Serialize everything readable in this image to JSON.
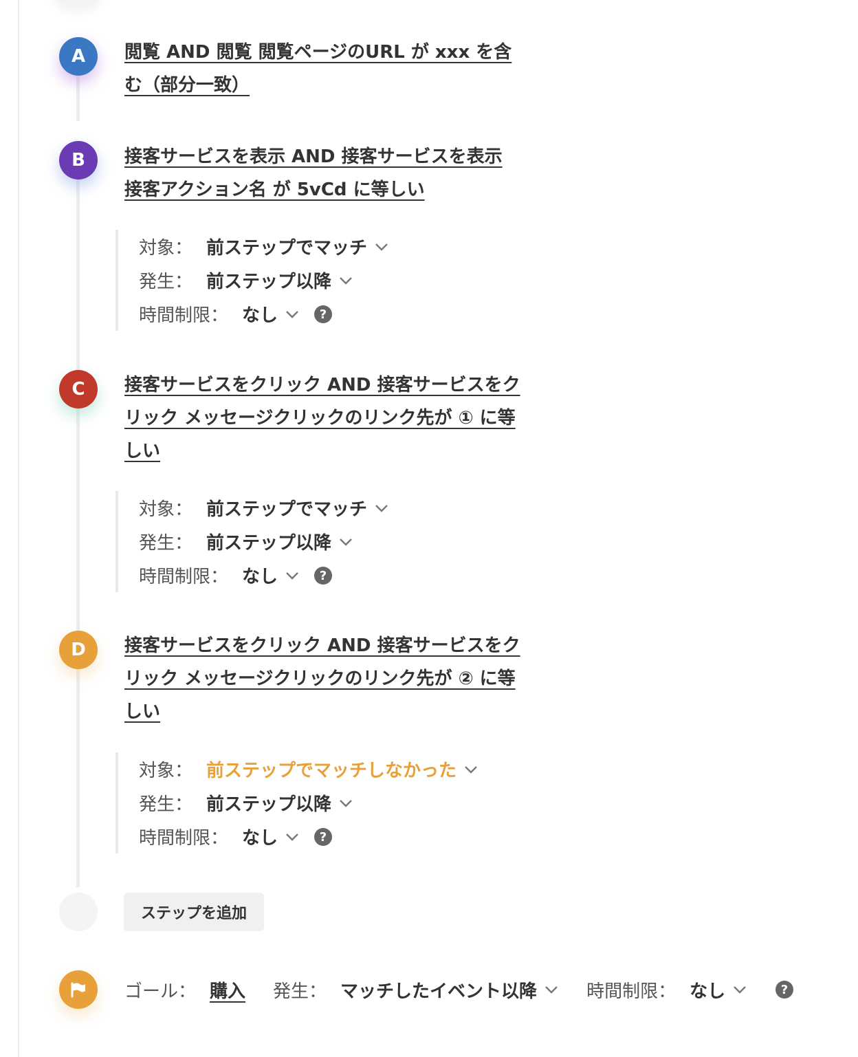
{
  "steps": [
    {
      "letter": "A",
      "title": "閲覧 AND 閲覧 閲覧ページのURL が xxx を含む（部分一致）"
    },
    {
      "letter": "B",
      "title": "接客サービスを表示 AND 接客サービスを表示 接客アクション名 が 5vCd に等しい",
      "target_label": "対象：",
      "target_value": "前ステップでマッチ",
      "occur_label": "発生：",
      "occur_value": "前ステップ以降",
      "time_label": "時間制限：",
      "time_value": "なし"
    },
    {
      "letter": "C",
      "title": "接客サービスをクリック AND 接客サービスをクリック メッセージクリックのリンク先が ① に等しい",
      "target_label": "対象：",
      "target_value": "前ステップでマッチ",
      "occur_label": "発生：",
      "occur_value": "前ステップ以降",
      "time_label": "時間制限：",
      "time_value": "なし"
    },
    {
      "letter": "D",
      "title": "接客サービスをクリック AND 接客サービスをクリック メッセージクリックのリンク先が ② に等しい",
      "target_label": "対象：",
      "target_value": "前ステップでマッチしなかった",
      "occur_label": "発生：",
      "occur_value": "前ステップ以降",
      "time_label": "時間制限：",
      "time_value": "なし"
    }
  ],
  "add_step_label": "ステップを追加",
  "goal": {
    "label": "ゴール：",
    "value": "購入",
    "occur_label": "発生：",
    "occur_value": "マッチしたイベント以降",
    "time_label": "時間制限：",
    "time_value": "なし"
  },
  "icons": {
    "dropdown": "chevron-down-icon",
    "help": "question-circle-icon",
    "goal": "flag-icon"
  },
  "colors": {
    "step_a": "#3b78c4",
    "step_b": "#6a3bb3",
    "step_c": "#c0392b",
    "step_d": "#e8a03a",
    "warning_text": "#e8a03a"
  }
}
